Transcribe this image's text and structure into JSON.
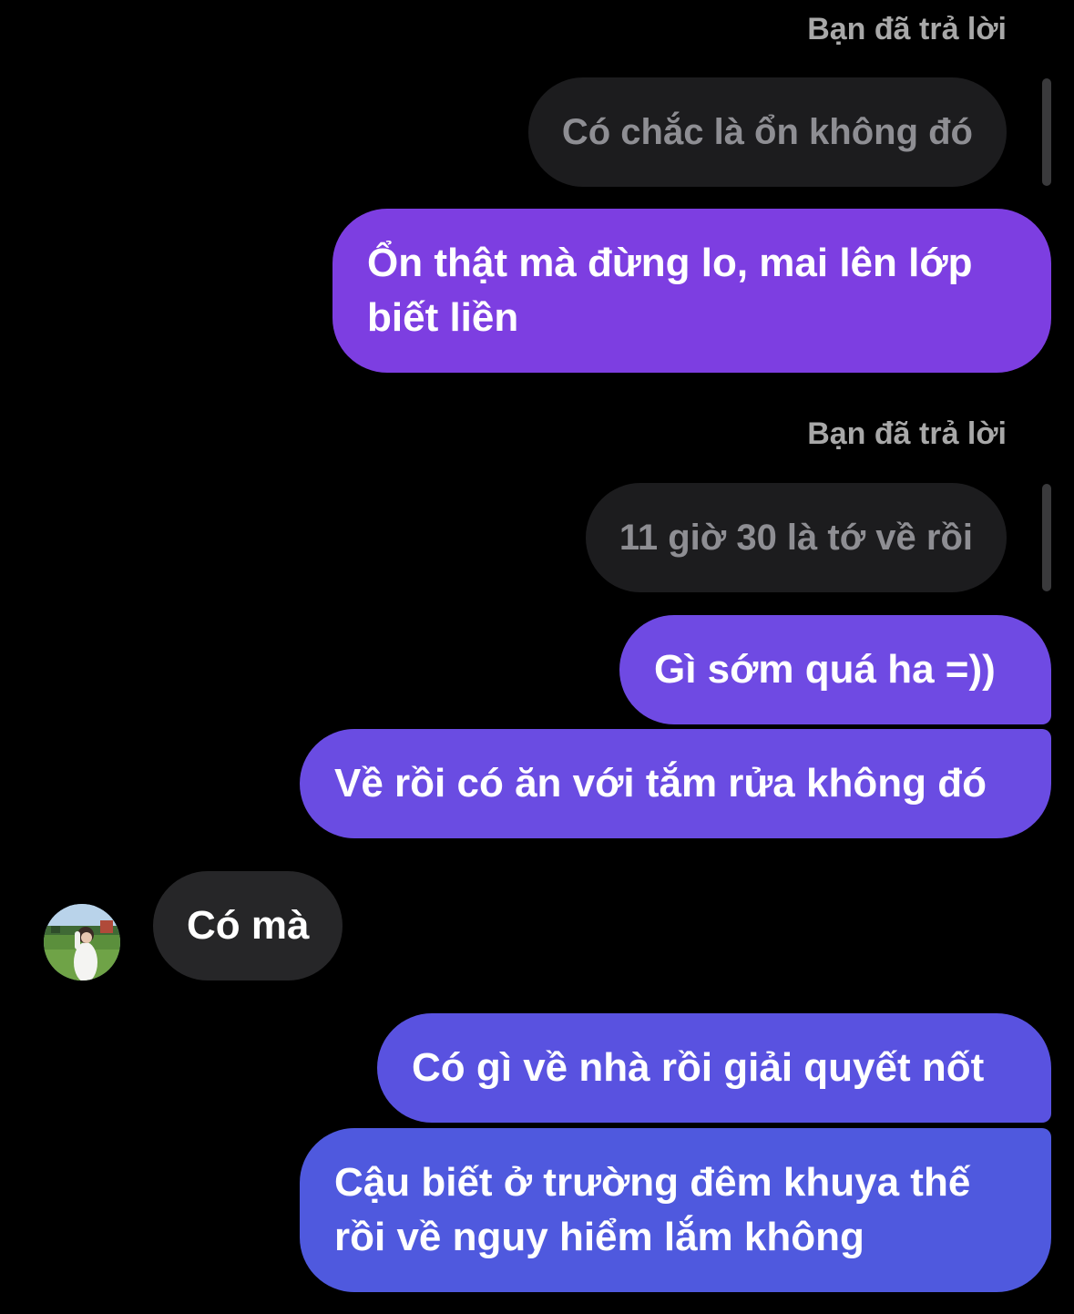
{
  "thread": {
    "reply_label_1": "Bạn đã trả lời",
    "quoted_1": "Có chắc là ổn không đó",
    "msg_1_line1": "Ổn thật mà đừng lo, mai lên lớp",
    "msg_1_line2": "biết liền",
    "reply_label_2": "Bạn đã trả lời",
    "quoted_2": "11 giờ 30 là tớ về rồi",
    "msg_2": "Gì sớm quá ha =))",
    "msg_3": "Về rồi có ăn với tắm rửa không đó",
    "incoming_1": "Có mà",
    "msg_4": "Có gì về nhà rồi giải quyết nốt",
    "msg_5_line1": "Cậu biết ở trường đêm khuya thế",
    "msg_5_line2": "rồi về nguy hiểm lắm không"
  },
  "colors": {
    "background": "#000000",
    "outgoing_gradient_top": "#8238E0",
    "outgoing_gradient_bottom": "#4B5BDD",
    "incoming_bubble": "#262628",
    "quoted_bubble": "#1c1c1e",
    "reply_label": "#a8a8a8"
  },
  "icons": {
    "avatar": "contact-avatar-photo"
  }
}
